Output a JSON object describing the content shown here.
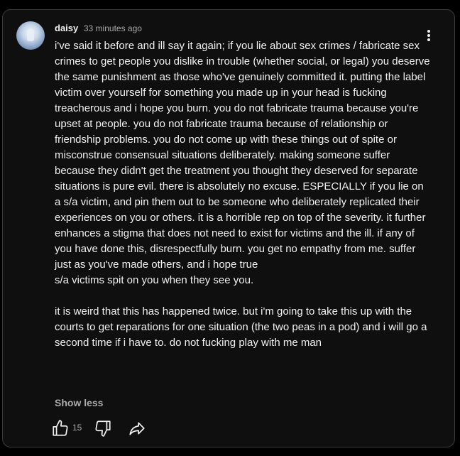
{
  "comment": {
    "author": "daisy",
    "timestamp": "33 minutes ago",
    "text": "i've said it before and ill say it again; if you lie about sex crimes / fabricate sex crimes to get people you dislike in trouble (whether social, or legal) you deserve the same punishment as those who've genuinely committed it. putting the label victim over yourself for something you made up in your head is fucking treacherous and i hope you burn. you do not fabricate trauma because you're upset at people. you do not fabricate trauma because of relationship or friendship problems. you do not come up with these things out of spite or misconstrue consensual situations deliberately. making someone suffer because they didn't get the treatment you thought they deserved for separate situations is pure evil. there is absolutely no excuse. ESPECIALLY if you lie on a s/a victim, and pin them out to be someone who deliberately replicated their experiences on you or others. it is a horrible rep on top of the severity. it further enhances a stigma that does not need to exist for victims and the ill. if any of you have done this, disrespectfully burn. you get no empathy from me. suffer just as you've made others, and i hope true\ns/a victims spit on you when they see you.\n\nit is weird that this has happened twice. but i'm going to take this up with the courts to get reparations for one situation (the two peas in a pod) and i will go a second time if i have to. do not fucking play with me man",
    "show_less_label": "Show less",
    "like_count": "15"
  },
  "icons": {
    "avatar": "user-avatar",
    "menu": "more-vertical-icon",
    "like": "thumbs-up-icon",
    "dislike": "thumbs-down-icon",
    "share": "share-arrow-icon"
  },
  "colors": {
    "background": "#0f0f0f",
    "primary_text": "#f1f1f1",
    "secondary_text": "#aaaaaa",
    "border": "#3a3a3a"
  }
}
